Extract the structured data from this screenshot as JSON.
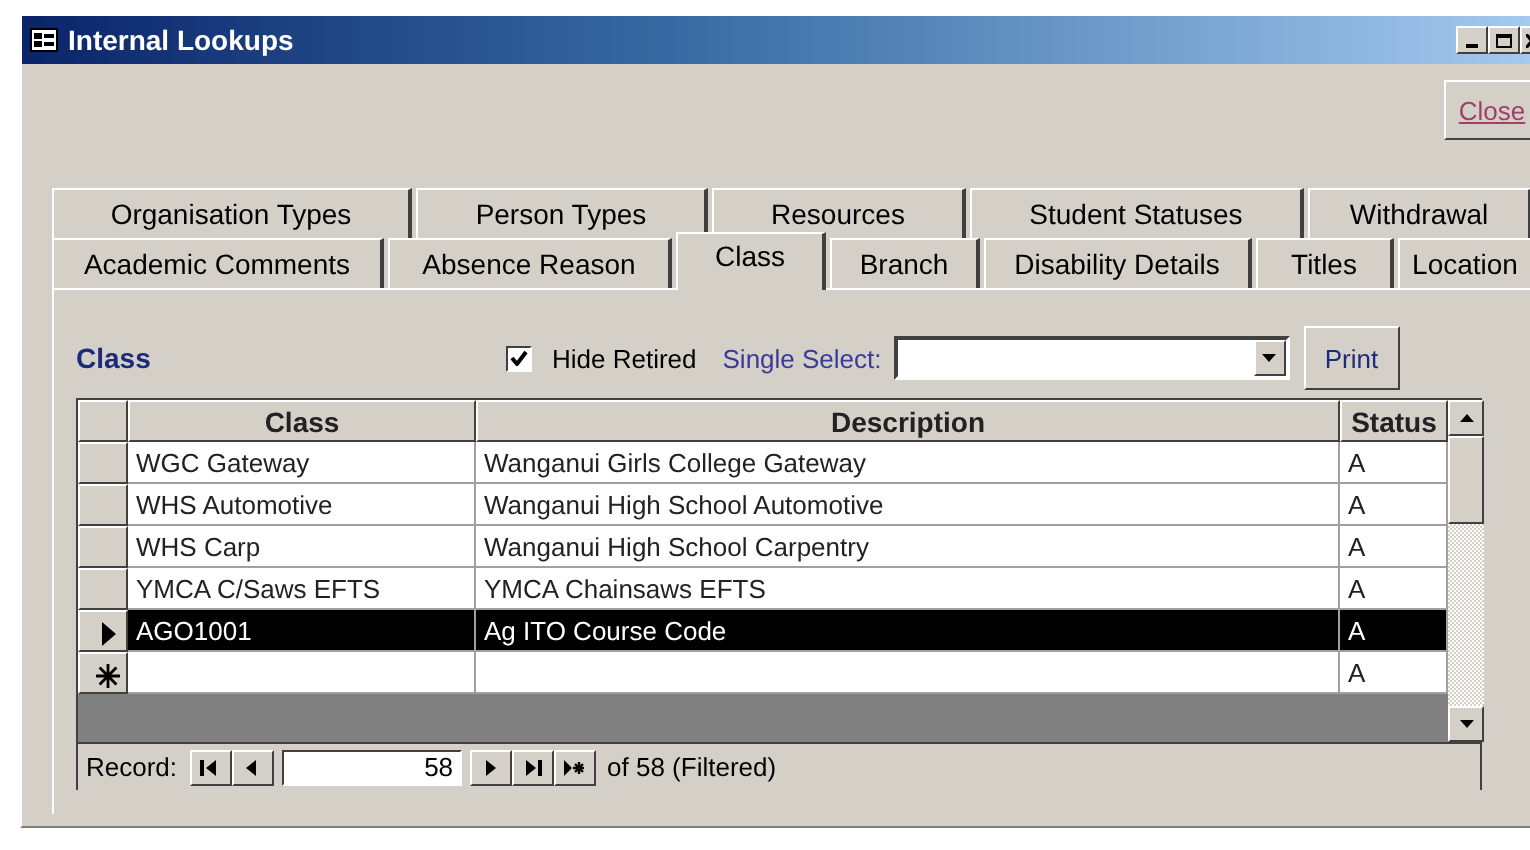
{
  "window": {
    "title": "Internal Lookups"
  },
  "close_button": "Close",
  "tab_rows": [
    [
      {
        "label": "Organisation Types",
        "selected": false
      },
      {
        "label": "Person Types",
        "selected": false
      },
      {
        "label": "Resources",
        "selected": false
      },
      {
        "label": "Student Statuses",
        "selected": false
      },
      {
        "label": "Withdrawal",
        "selected": false
      }
    ],
    [
      {
        "label": "Academic Comments",
        "selected": false
      },
      {
        "label": "Absence Reason",
        "selected": false
      },
      {
        "label": "Class",
        "selected": true
      },
      {
        "label": "Branch",
        "selected": false
      },
      {
        "label": "Disability Details",
        "selected": false
      },
      {
        "label": "Titles",
        "selected": false
      },
      {
        "label": "Location",
        "selected": false
      }
    ]
  ],
  "panel": {
    "heading": "Class",
    "hide_retired": {
      "label": "Hide Retired",
      "checked": true
    },
    "single_select": {
      "label": "Single Select:"
    },
    "print_button": "Print"
  },
  "table": {
    "columns": [
      "Class",
      "Description",
      "Status"
    ],
    "rows": [
      {
        "kind": "record",
        "selected": false,
        "class": "WGC Gateway",
        "description": "Wanganui Girls College Gateway",
        "status": "A"
      },
      {
        "kind": "record",
        "selected": false,
        "class": "WHS Automotive",
        "description": "Wanganui High School Automotive",
        "status": "A"
      },
      {
        "kind": "record",
        "selected": false,
        "class": "WHS Carp",
        "description": "Wanganui High School Carpentry",
        "status": "A"
      },
      {
        "kind": "record",
        "selected": false,
        "class": "YMCA C/Saws EFTS",
        "description": "YMCA Chainsaws EFTS",
        "status": "A"
      },
      {
        "kind": "record",
        "selected": true,
        "class": "AGO1001",
        "description": "Ag ITO Course Code",
        "status": "A"
      },
      {
        "kind": "new",
        "selected": false,
        "status": "A"
      }
    ]
  },
  "record_nav": {
    "label": "Record:",
    "value": "58",
    "total": "of 58 (Filtered)"
  }
}
